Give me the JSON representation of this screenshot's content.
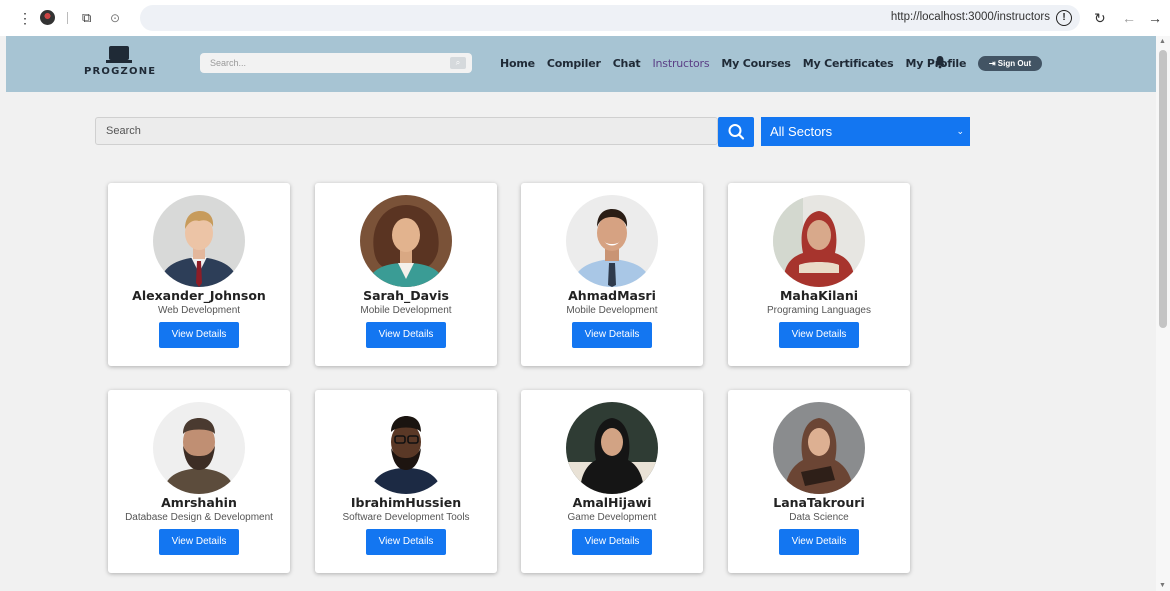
{
  "browser": {
    "url": "http://localhost:3000/instructors",
    "icons": [
      "menu-dots-icon",
      "profile-icon",
      "tab-icon",
      "extension-icon",
      "star-icon",
      "zoom-icon",
      "info-icon",
      "reload-icon",
      "back-icon",
      "forward-icon"
    ]
  },
  "nav": {
    "logo_text": "PROGZONE",
    "search_placeholder": "Search...",
    "links": [
      {
        "label": "Home"
      },
      {
        "label": "Compiler"
      },
      {
        "label": "Chat"
      },
      {
        "label": "Instructors",
        "active": true
      },
      {
        "label": "My Courses"
      },
      {
        "label": "My Certificates"
      },
      {
        "label": "My Profile"
      }
    ],
    "sign_out_label": "Sign Out",
    "colors": {
      "bar": "#a7c4d3",
      "active_link": "#5b3f86",
      "sign_out_bg": "#425464"
    }
  },
  "filters": {
    "search_placeholder": "Search",
    "sector_selected": "All Sectors",
    "accent": "#1376f1"
  },
  "instructors": [
    {
      "name": "Alexander_Johnson",
      "sector": "Web Development",
      "button": "View Details"
    },
    {
      "name": "Sarah_Davis",
      "sector": "Mobile Development",
      "button": "View Details"
    },
    {
      "name": "AhmadMasri",
      "sector": "Mobile Development",
      "button": "View Details"
    },
    {
      "name": "MahaKilani",
      "sector": "Programing Languages",
      "button": "View Details"
    },
    {
      "name": "Amrshahin",
      "sector": "Database Design & Development",
      "button": "View Details"
    },
    {
      "name": "IbrahimHussien",
      "sector": "Software Development Tools",
      "button": "View Details"
    },
    {
      "name": "AmalHijawi",
      "sector": "Game Development",
      "button": "View Details"
    },
    {
      "name": "LanaTakrouri",
      "sector": "Data Science",
      "button": "View Details"
    }
  ]
}
